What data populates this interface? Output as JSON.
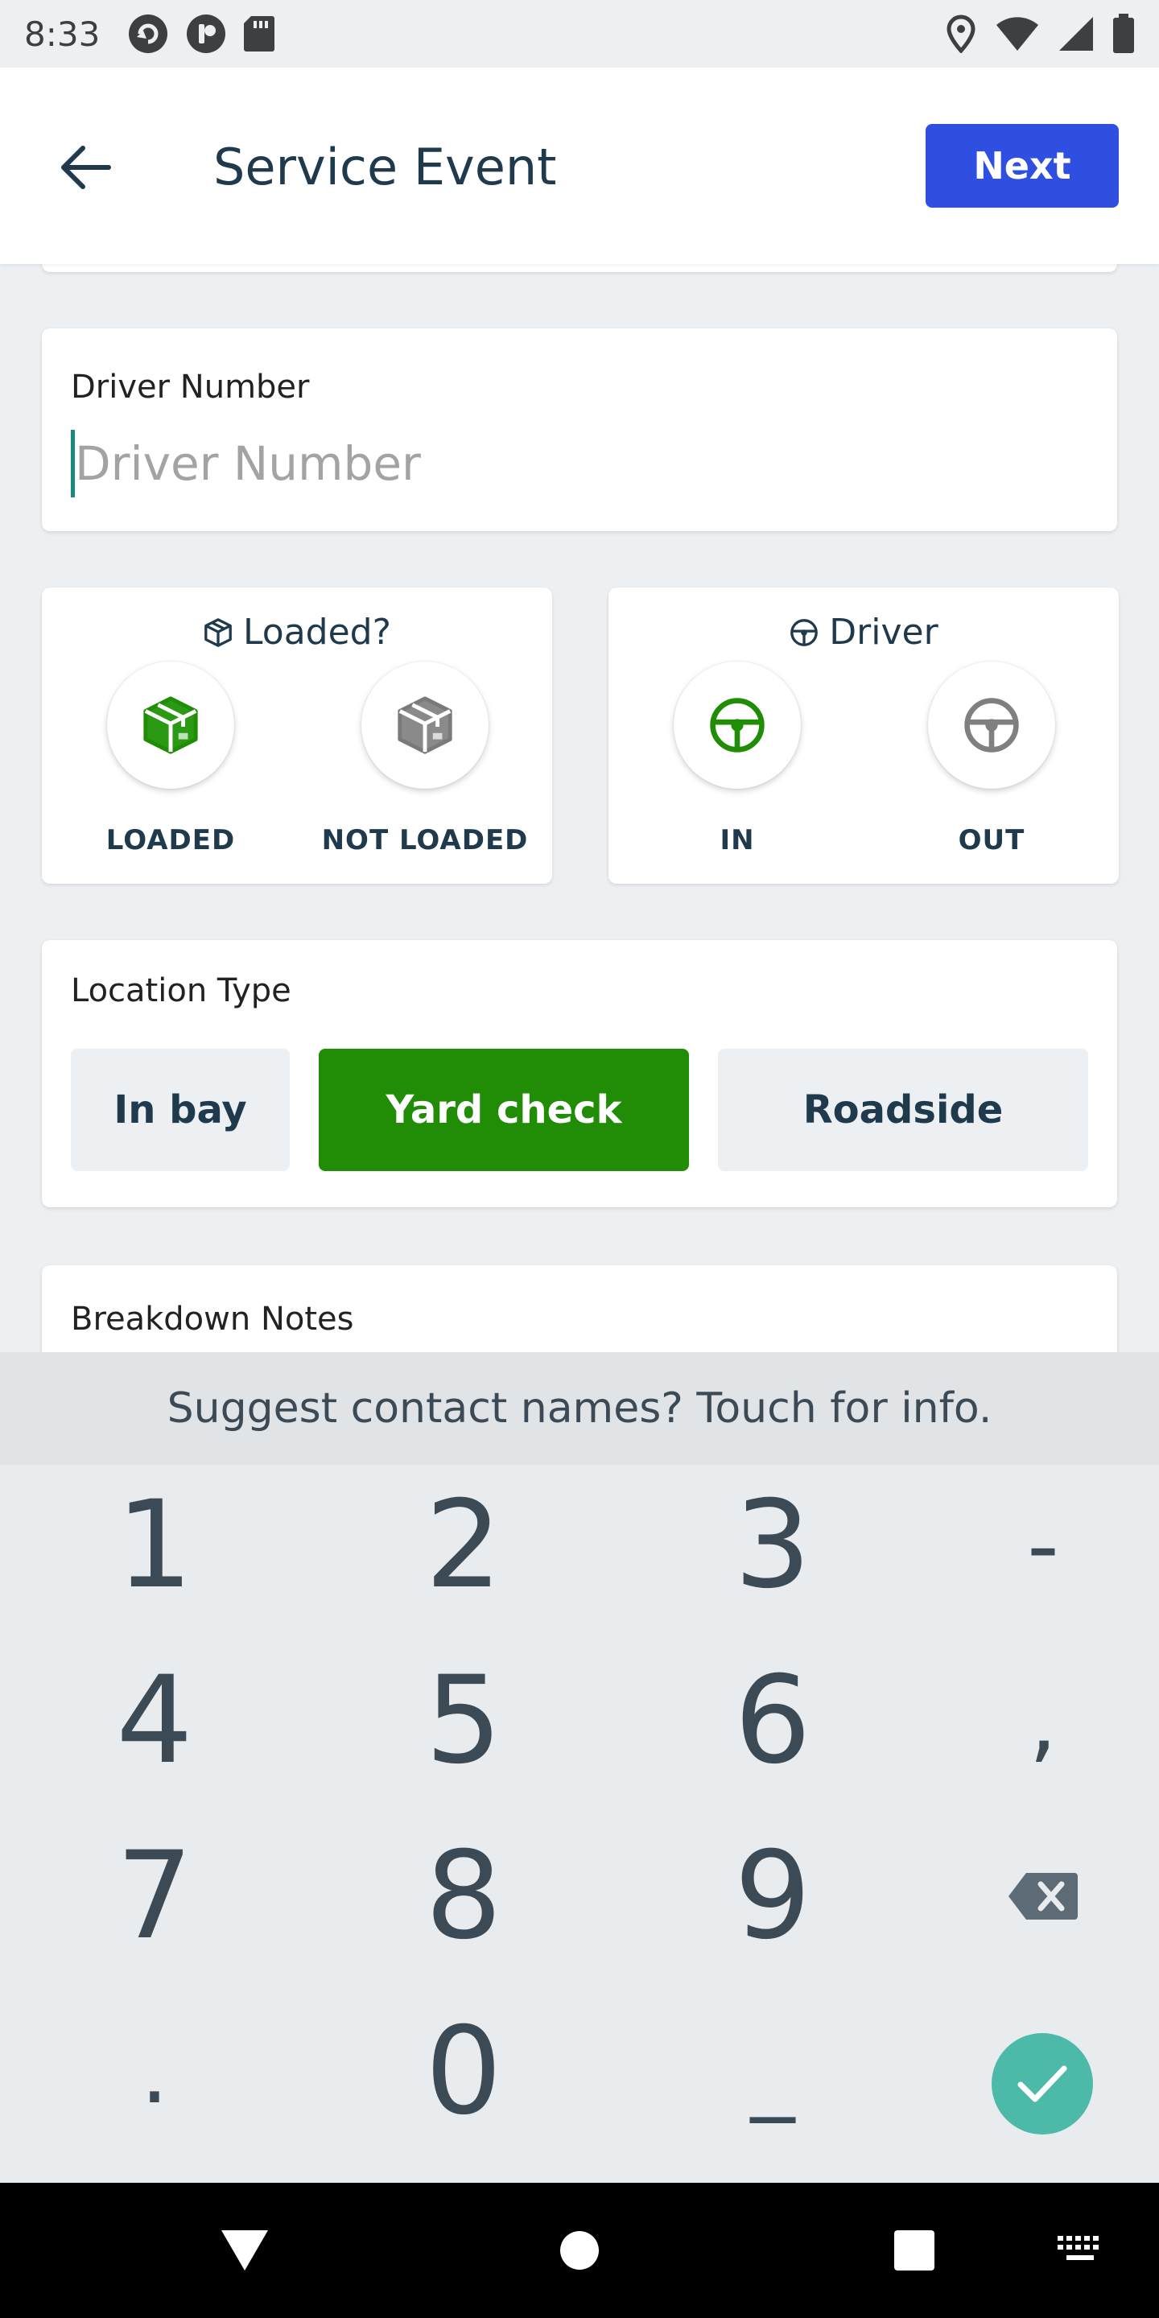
{
  "status_bar": {
    "time": "8:33"
  },
  "app_bar": {
    "title": "Service Event",
    "next_label": "Next"
  },
  "driver_number": {
    "label": "Driver Number",
    "placeholder": "Driver Number",
    "value": ""
  },
  "loaded": {
    "title": "Loaded?",
    "options": [
      {
        "label": "LOADED",
        "selected": true,
        "icon": "box-icon"
      },
      {
        "label": "NOT LOADED",
        "selected": false,
        "icon": "box-icon"
      }
    ]
  },
  "driver": {
    "title": "Driver",
    "options": [
      {
        "label": "IN",
        "selected": true,
        "icon": "steering-wheel-icon"
      },
      {
        "label": "OUT",
        "selected": false,
        "icon": "steering-wheel-icon"
      }
    ]
  },
  "location_type": {
    "label": "Location Type",
    "options": [
      "In bay",
      "Yard check",
      "Roadside"
    ],
    "selected": "Yard check"
  },
  "breakdown_notes": {
    "label": "Breakdown Notes"
  },
  "keyboard": {
    "suggestion": "Suggest contact names? Touch for info.",
    "keys": [
      "1",
      "2",
      "3",
      "-",
      "4",
      "5",
      "6",
      ",",
      "7",
      "8",
      "9",
      ".",
      "0",
      "_"
    ]
  },
  "colors": {
    "accent_blue": "#2e4fe0",
    "selected_green": "#218c06",
    "cursor_teal": "#1a8a7c",
    "done_teal": "#4dbaa9",
    "text_dark": "#1f3a4d"
  }
}
